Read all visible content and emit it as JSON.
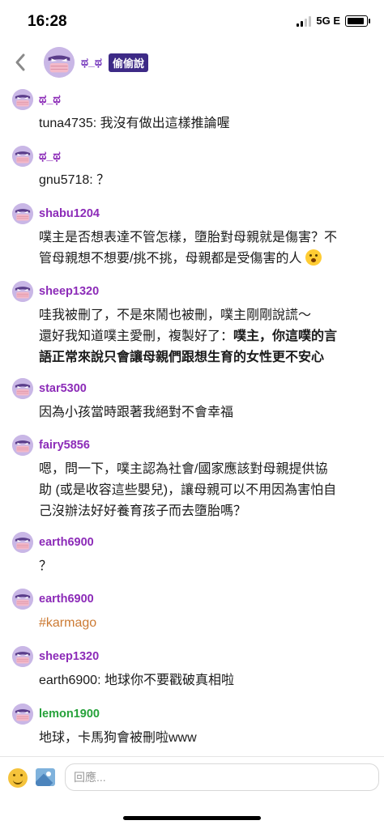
{
  "status": {
    "time": "16:28",
    "network": "5G E"
  },
  "header": {
    "title": "ಥ_ಥ",
    "badge": "偷偷說"
  },
  "messages": [
    {
      "user": "ಥ_ಥ",
      "lines": [
        {
          "segments": [
            {
              "text": "tuna4735: 我沒有做出這樣推論喔"
            }
          ]
        }
      ]
    },
    {
      "user": "ಥ_ಥ",
      "lines": [
        {
          "segments": [
            {
              "text": "gnu5718: ？"
            }
          ]
        }
      ]
    },
    {
      "user": "shabu1204",
      "lines": [
        {
          "segments": [
            {
              "text": "噗主是否想表達不管怎樣，墮胎對母親就是傷害？不"
            }
          ]
        },
        {
          "segments": [
            {
              "text": "管母親想不想要/挑不挑，母親都是受傷害的人 "
            },
            {
              "emoji": "astonished-face"
            }
          ]
        }
      ]
    },
    {
      "user": "sheep1320",
      "lines": [
        {
          "segments": [
            {
              "text": "哇我被刪了，不是來鬧也被刪，噗主剛剛說謊～"
            }
          ]
        },
        {
          "segments": [
            {
              "text": "還好我知道噗主愛刪，複製好了："
            },
            {
              "text": "噗主，你這噗的言",
              "bold": true
            }
          ]
        },
        {
          "segments": [
            {
              "text": "語正常來說只會讓母親們跟想生育的女性更不安心",
              "bold": true
            }
          ]
        }
      ]
    },
    {
      "user": "star5300",
      "lines": [
        {
          "segments": [
            {
              "text": "因為小孩當時跟著我絕對不會幸福"
            }
          ]
        }
      ]
    },
    {
      "user": "fairy5856",
      "lines": [
        {
          "segments": [
            {
              "text": "嗯，問一下，噗主認為社會/國家應該對母親提供協"
            }
          ]
        },
        {
          "segments": [
            {
              "text": "助 (或是收容這些嬰兒)，讓母親可以不用因為害怕自"
            }
          ]
        },
        {
          "segments": [
            {
              "text": "己沒辦法好好養育孩子而去墮胎嗎？"
            }
          ]
        }
      ]
    },
    {
      "user": "earth6900",
      "lines": [
        {
          "segments": [
            {
              "text": "？"
            }
          ]
        }
      ]
    },
    {
      "user": "earth6900",
      "lines": [
        {
          "segments": [
            {
              "text": "#karmago",
              "tag": true
            }
          ]
        }
      ]
    },
    {
      "user": "sheep1320",
      "lines": [
        {
          "segments": [
            {
              "text": "earth6900: 地球你不要戳破真相啦"
            }
          ]
        }
      ]
    },
    {
      "user": "lemon1900",
      "user_color": "green",
      "lines": [
        {
          "segments": [
            {
              "text": "地球，卡馬狗會被刪啦www"
            }
          ]
        }
      ]
    }
  ],
  "input": {
    "placeholder": "回應..."
  },
  "icons": {
    "back": "chevron-left-icon",
    "emoji": "smiley-icon",
    "image": "image-icon"
  },
  "colors": {
    "username": "#8c2bb8",
    "username_green": "#26a23a",
    "badge_bg": "#3d2a86",
    "hashtag": "#cc7a33"
  }
}
